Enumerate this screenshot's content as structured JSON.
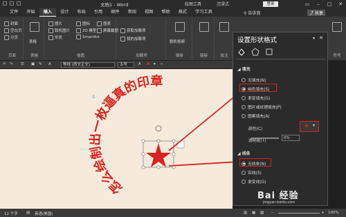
{
  "window": {
    "doc_title": "文档1 - Word",
    "ctx_tool1": "绘图工具",
    "ctx_tool2": "沉浸式",
    "login": "登录"
  },
  "tabs": [
    "文件",
    "开始",
    "插入",
    "设计",
    "布局",
    "引用",
    "邮件",
    "审阅",
    "视图",
    "帮助",
    "格式",
    "学习工具"
  ],
  "active_tab": "插入",
  "tellme": "告诉我",
  "share": "共享",
  "ribbon": {
    "pages_items": [
      "封面",
      "空白页",
      "分页"
    ],
    "pages_label": "页面",
    "table_label": "表格",
    "table_group": "表格",
    "illus_items": [
      "图片",
      "联机图片",
      "形状",
      "图标",
      "3D 模型",
      "SmartArt",
      "图表",
      "屏幕截图"
    ],
    "illus_label": "插图",
    "addin_items": [
      "获取加载项",
      "我的加载项"
    ],
    "addin_label": "加载项",
    "media_item": "联机视频",
    "media_label": "媒体",
    "link_label": "链接",
    "comment_label": "批注",
    "header_label": "页眉和页脚",
    "text_label": "文本",
    "symbol_label": "符号"
  },
  "fmtbar": {
    "font": "等线 (西文正文)",
    "size": "五号"
  },
  "stamp": {
    "text": "怎么绘制出一枚逼真的印章"
  },
  "pane": {
    "title": "设置形状格式",
    "fill_section": "填充",
    "fill_options": [
      "无填充(N)",
      "纯色填充(S)",
      "渐变填充(G)",
      "图片或纹理填充(P)",
      "图案填充(A)"
    ],
    "selected_fill": 1,
    "color_label": "颜色(C)",
    "transparency_label": "透明度(T)",
    "transparency_value": "0%",
    "line_section": "线条",
    "line_options": [
      "无线条(N)",
      "实线(S)",
      "渐变线(G)"
    ],
    "selected_line": 0
  },
  "status": {
    "words": "12 个字",
    "lang": "英语(美国)",
    "zoom": "100%"
  },
  "watermark": {
    "brand": "Bai 经验",
    "url": "jingyan.baidu.com"
  },
  "colors": {
    "accent_red": "#d9231f",
    "doc_bg": "#f5eadc",
    "pane_bg": "#2b2b2b"
  }
}
